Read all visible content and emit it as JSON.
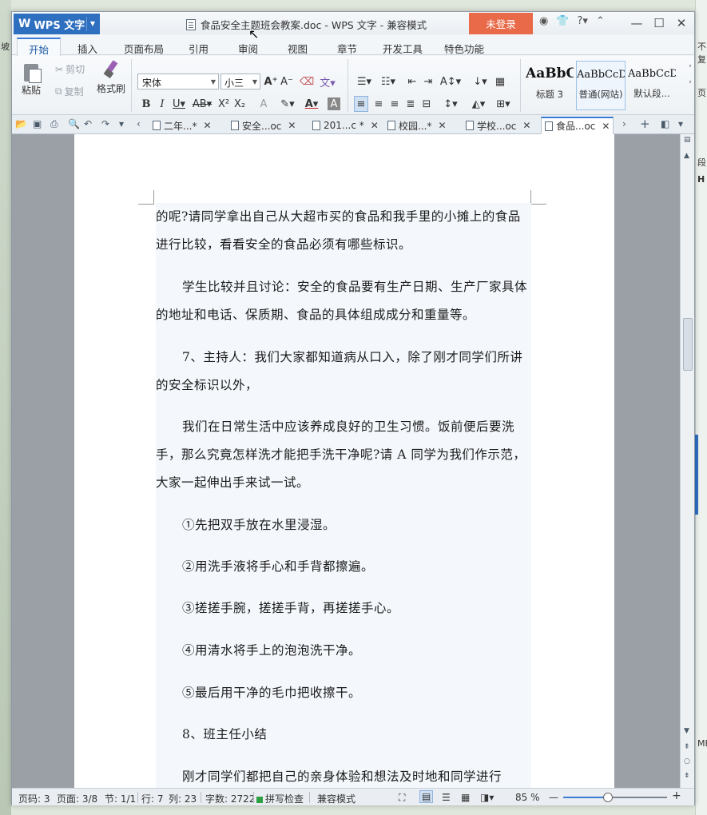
{
  "window": {
    "app_button": "WPS 文字",
    "title": "食品安全主题班会教案.doc - WPS 文字 - 兼容模式",
    "login": "未登录"
  },
  "menu": {
    "tabs": [
      "开始",
      "插入",
      "页面布局",
      "引用",
      "审阅",
      "视图",
      "章节",
      "开发工具",
      "特色功能"
    ]
  },
  "ribbon": {
    "paste": "粘贴",
    "cut": "剪切",
    "copy": "复制",
    "format_painter": "格式刷",
    "font_name": "宋体",
    "font_size": "小三",
    "styles": [
      {
        "sample": "AaBbC",
        "label": "标题 3"
      },
      {
        "sample": "AaBbCcD",
        "label": "普通(网站)"
      },
      {
        "sample": "AaBbCcDd",
        "label": "默认段..."
      }
    ]
  },
  "doc_tabs": [
    "二年...*",
    "安全...oc",
    "201...c *",
    "校园...*",
    "学校...oc",
    "食品...oc"
  ],
  "document": {
    "paragraphs": [
      "的呢?请同学拿出自己从大超市买的食品和我手里的小摊上的食品进行比较，看看安全的食品必须有哪些标识。",
      "学生比较并且讨论：安全的食品要有生产日期、生产厂家具体的地址和电话、保质期、食品的具体组成成分和重量等。",
      "7、主持人：我们大家都知道病从口入，除了刚才同学们所讲的安全标识以外，",
      "我们在日常生活中应该养成良好的卫生习惯。饭前便后要洗手，那么究竟怎样洗才能把手洗干净呢?请 A 同学为我们作示范，大家一起伸出手来试一试。",
      "①先把双手放在水里浸湿。",
      "②用洗手液将手心和手背都擦遍。",
      "③搓搓手腕，搓搓手背，再搓搓手心。",
      "④用清水将手上的泡泡洗干净。",
      "⑤最后用干净的毛巾把收擦干。",
      "8、班主任小结",
      "刚才同学们都把自己的亲身体验和想法及时地和同学进行"
    ]
  },
  "status": {
    "page_num": "页码: 3",
    "pages": "页面: 3/8",
    "section": "节: 1/1",
    "row": "行: 7",
    "col": "列: 23",
    "words": "字数: 2722",
    "spell": "拼写检查",
    "mode": "兼容模式",
    "zoom": "85 %",
    "zoom_fraction": 0.43
  },
  "colors": {
    "accent": "#2e6fbf",
    "login": "#e86a48",
    "text_bg": "#f4f8fc"
  },
  "icons": [
    "paste-icon",
    "cut-icon",
    "copy-icon",
    "format-painter-icon",
    "bold-icon",
    "italic-icon",
    "underline-icon",
    "close-icon",
    "minimize-icon",
    "maximize-icon"
  ],
  "background_fragments": {
    "left": [
      "坡"
    ],
    "right": [
      "不复",
      "页",
      "段",
      "H",
      "ME"
    ]
  }
}
